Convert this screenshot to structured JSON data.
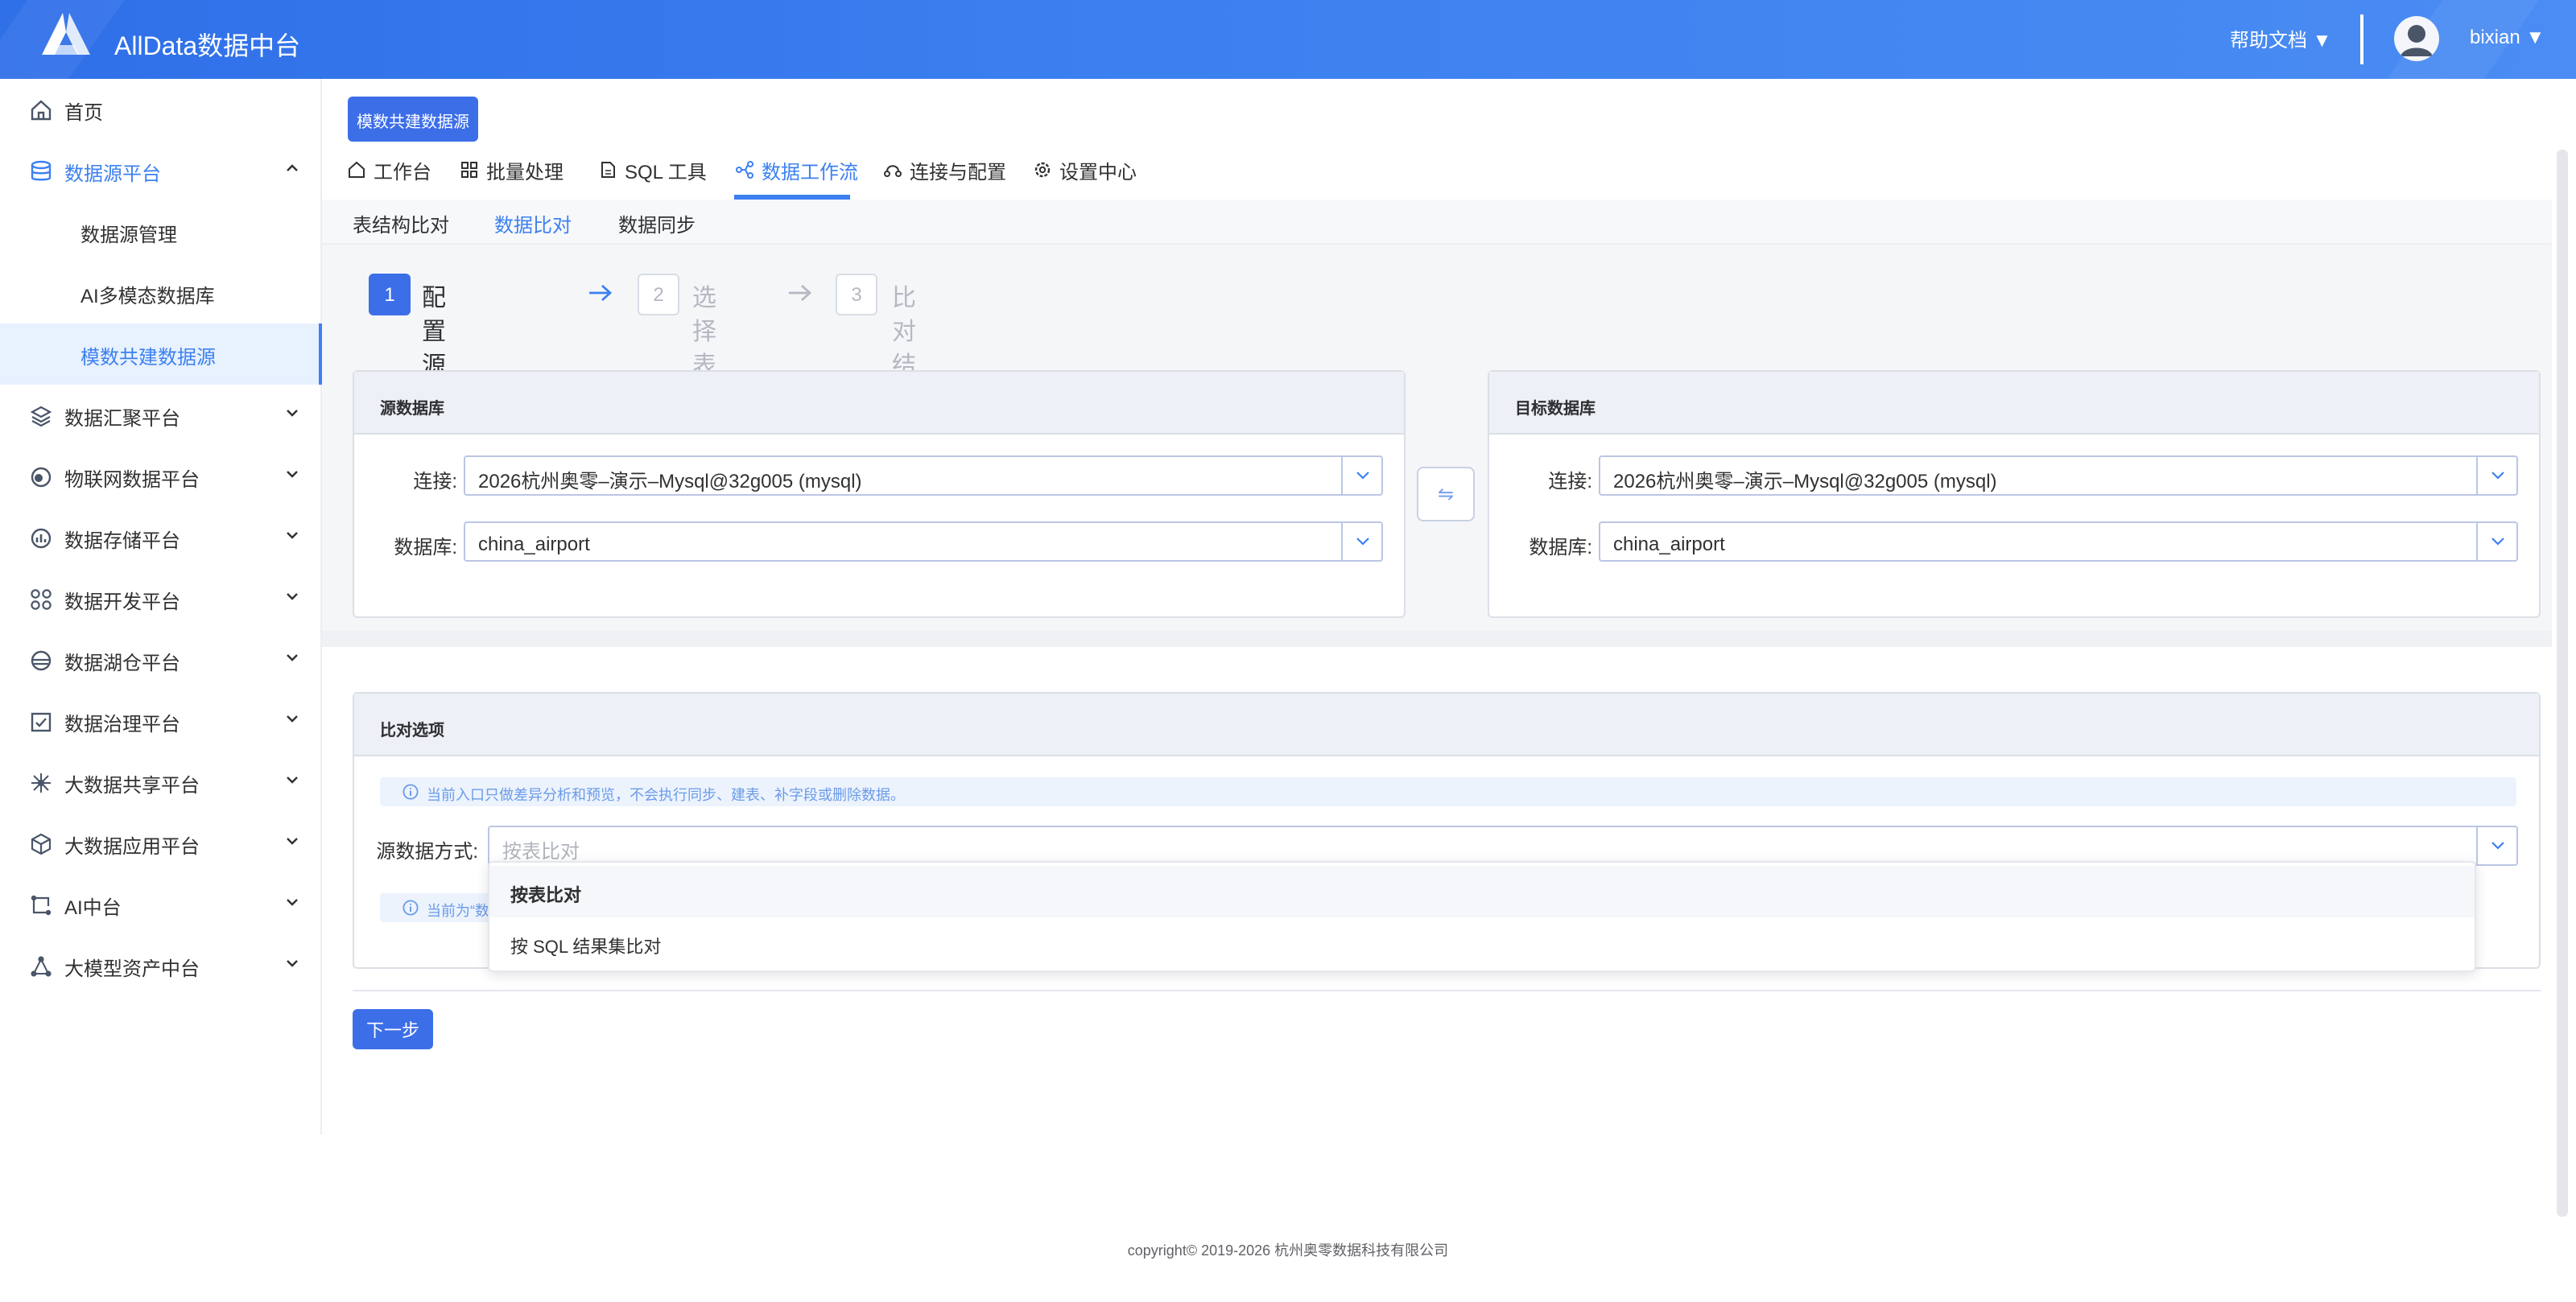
{
  "header": {
    "title": "AllData数据中台",
    "help": "帮助文档 ▼",
    "username": "bixian ▼"
  },
  "sidebar": {
    "items": [
      {
        "label": "首页",
        "icon": "home-icon"
      },
      {
        "label": "数据源平台",
        "icon": "database-icon",
        "expanded": true
      },
      {
        "label": "数据源管理",
        "sub": true
      },
      {
        "label": "AI多模态数据库",
        "sub": true
      },
      {
        "label": "模数共建数据源",
        "sub": true,
        "active": true
      },
      {
        "label": "数据汇聚平台",
        "icon": "layers-icon"
      },
      {
        "label": "物联网数据平台",
        "icon": "iot-icon"
      },
      {
        "label": "数据存储平台",
        "icon": "storage-icon"
      },
      {
        "label": "数据开发平台",
        "icon": "dev-icon"
      },
      {
        "label": "数据湖仓平台",
        "icon": "lake-icon"
      },
      {
        "label": "数据治理平台",
        "icon": "govern-icon"
      },
      {
        "label": "大数据共享平台",
        "icon": "share-icon"
      },
      {
        "label": "大数据应用平台",
        "icon": "cube-icon"
      },
      {
        "label": "AI中台",
        "icon": "ai-icon"
      },
      {
        "label": "大模型资产中台",
        "icon": "model-icon"
      }
    ]
  },
  "page_tag": "模数共建数据源",
  "top_tabs": [
    {
      "label": "工作台",
      "icon": "home-icon"
    },
    {
      "label": "批量处理",
      "icon": "grid-icon"
    },
    {
      "label": "SQL 工具",
      "icon": "file-icon"
    },
    {
      "label": "数据工作流",
      "icon": "workflow-icon",
      "active": true
    },
    {
      "label": "连接与配置",
      "icon": "connect-icon"
    },
    {
      "label": "设置中心",
      "icon": "gear-icon"
    }
  ],
  "sub_tabs": [
    {
      "label": "表结构比对"
    },
    {
      "label": "数据比对",
      "active": true
    },
    {
      "label": "数据同步"
    }
  ],
  "steps": [
    {
      "num": "1",
      "label": "配置源与目标"
    },
    {
      "num": "2",
      "label": "选择表"
    },
    {
      "num": "3",
      "label": "比对结果"
    }
  ],
  "source": {
    "title": "源数据库",
    "conn_label": "连接:",
    "conn_value": "2026杭州奥零–演示–Mysql@32g005 (mysql)",
    "db_label": "数据库:",
    "db_value": "china_airport"
  },
  "target": {
    "title": "目标数据库",
    "conn_label": "连接:",
    "conn_value": "2026杭州奥零–演示–Mysql@32g005 (mysql)",
    "db_label": "数据库:",
    "db_value": "china_airport"
  },
  "swap_symbol": "⇋",
  "options": {
    "title": "比对选项",
    "info": "当前入口只做差异分析和预览，不会执行同步、建表、补字段或删除数据。",
    "mode_label": "源数据方式:",
    "mode_placeholder": "按表比对",
    "info2": "当前为“数"
  },
  "dropdown": {
    "options": [
      "按表比对",
      "按 SQL 结果集比对"
    ]
  },
  "next_button": "下一步",
  "footer": "copyright© 2019-2026 杭州奥零数据科技有限公司"
}
